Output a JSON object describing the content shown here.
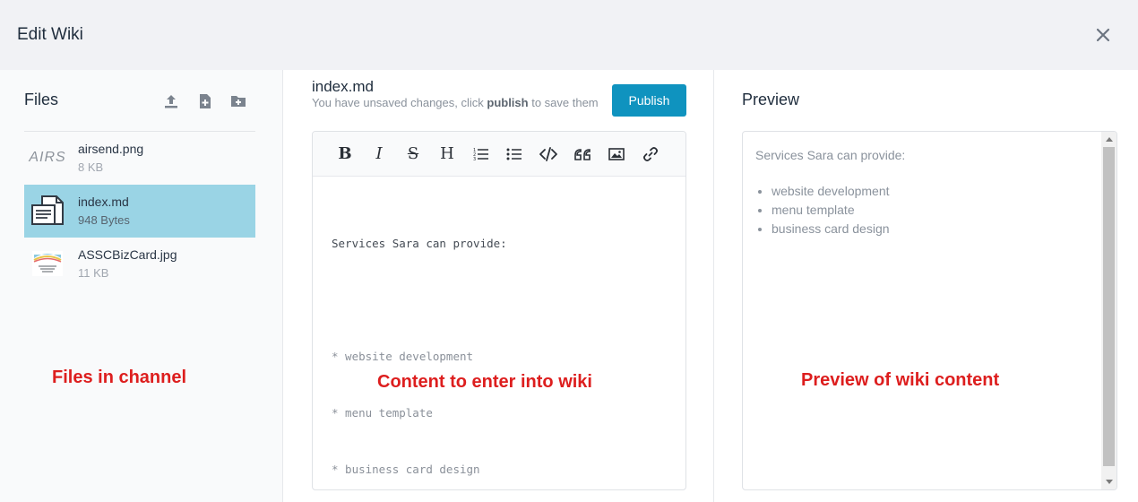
{
  "dialog": {
    "title": "Edit Wiki",
    "close_icon": "close-icon"
  },
  "files_panel": {
    "title": "Files",
    "tools": [
      {
        "name": "upload-icon"
      },
      {
        "name": "new-file-icon"
      },
      {
        "name": "new-folder-icon"
      }
    ],
    "items": [
      {
        "name": "airsend.png",
        "size": "8 KB",
        "thumb_text": "AIRS",
        "active": false
      },
      {
        "name": "index.md",
        "size": "948 Bytes",
        "active": true
      },
      {
        "name": "ASSCBizCard.jpg",
        "size": "11 KB",
        "active": false
      }
    ]
  },
  "editor_panel": {
    "doc_name": "index.md",
    "notice_before": "You have unsaved changes, click ",
    "notice_bold": "publish",
    "notice_after": " to save them",
    "publish_label": "Publish",
    "toolbar": {
      "bold": "B",
      "italic": "I",
      "strikethrough": "S",
      "heading": "H"
    },
    "content_lines": [
      "Services Sara can provide:",
      "",
      "* website development",
      "* menu template",
      "* business card design"
    ]
  },
  "preview_panel": {
    "title": "Preview",
    "intro": "Services Sara can provide:",
    "items": [
      "website development",
      "menu template",
      "business card design"
    ]
  },
  "annotations": {
    "files": "Files in channel",
    "content": "Content to enter into wiki",
    "preview": "Preview of wiki content"
  },
  "colors": {
    "accent": "#0f93bf",
    "active_row": "#9ad4e5",
    "annotation": "#dd1e1e"
  }
}
